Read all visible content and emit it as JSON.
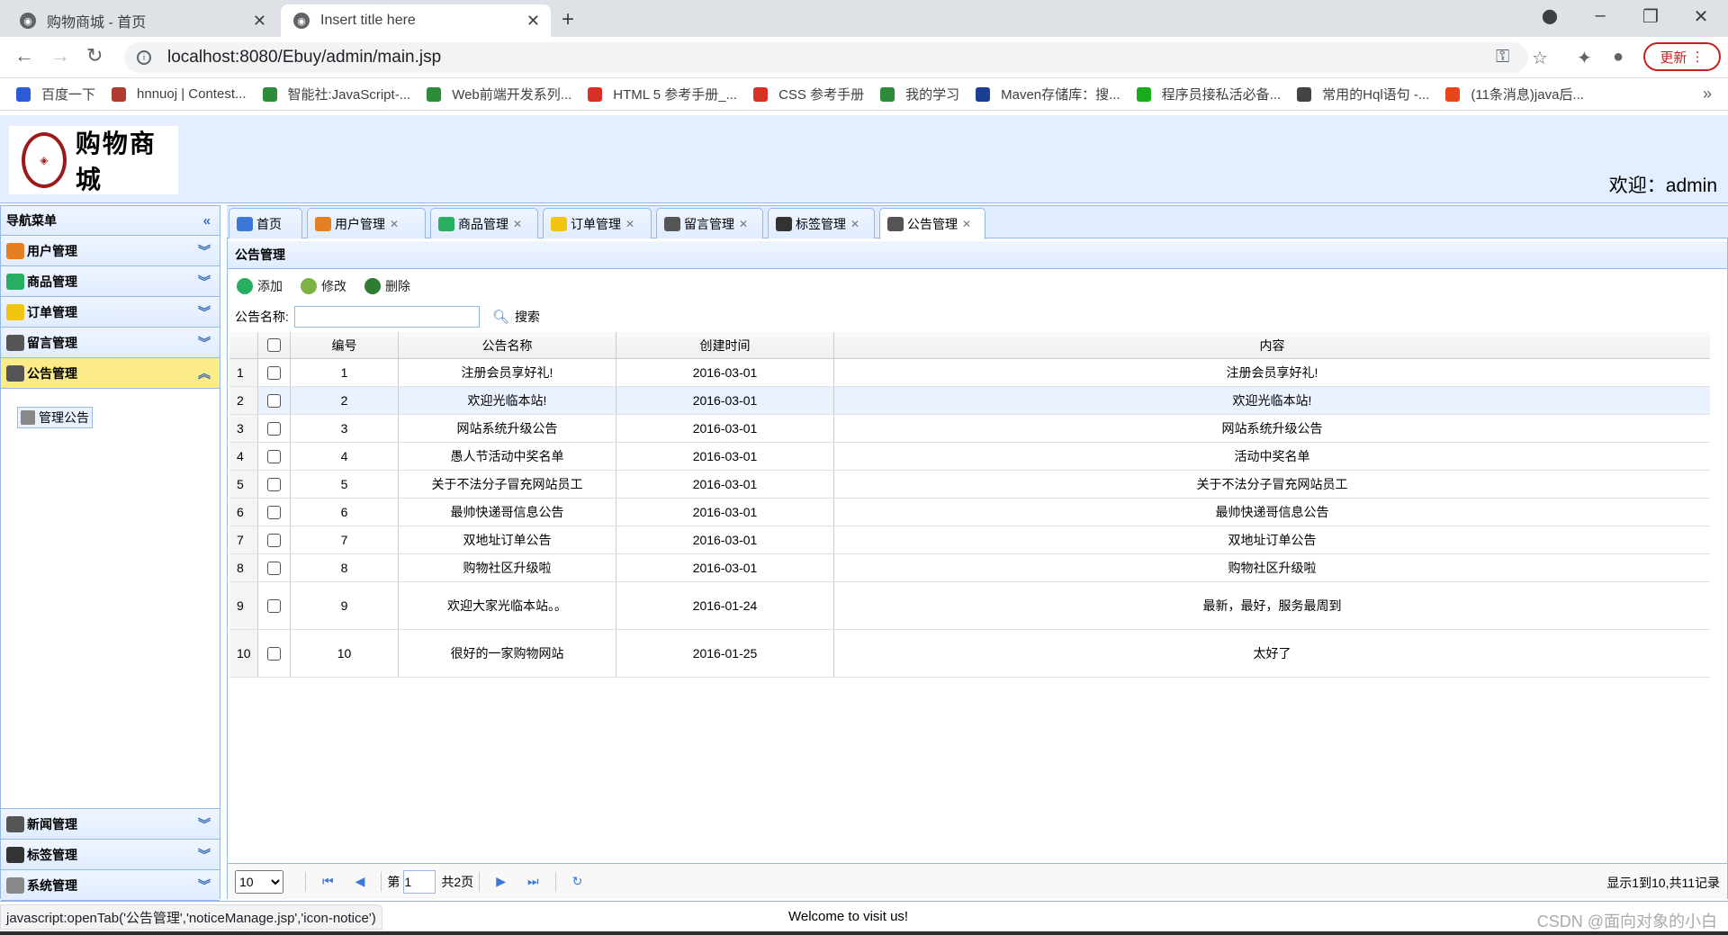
{
  "browser": {
    "tabs": [
      {
        "title": "购物商城 - 首页",
        "active": false
      },
      {
        "title": "Insert title here",
        "active": true
      }
    ],
    "url": "localhost:8080/Ebuy/admin/main.jsp",
    "update_label": "更新",
    "bookmarks": [
      {
        "label": "百度一下",
        "color": "#2b5bd7"
      },
      {
        "label": "hnnuoj | Contest...",
        "color": "#b03a2e"
      },
      {
        "label": "智能社:JavaScript-...",
        "color": "#2e8b3a"
      },
      {
        "label": "Web前端开发系列...",
        "color": "#2e8b3a"
      },
      {
        "label": "HTML 5 参考手册_...",
        "color": "#d93025"
      },
      {
        "label": "CSS 参考手册",
        "color": "#d93025"
      },
      {
        "label": "我的学习",
        "color": "#2e8b3a"
      },
      {
        "label": "Maven存储库：搜...",
        "color": "#1a3f8f"
      },
      {
        "label": "程序员接私活必备...",
        "color": "#1aad19"
      },
      {
        "label": "常用的Hql语句 -...",
        "color": "#444444"
      },
      {
        "label": "(11条消息)java后...",
        "color": "#e8461a"
      }
    ]
  },
  "header": {
    "logo_text": "购物商城",
    "welcome": "欢迎：admin"
  },
  "sidebar": {
    "title": "导航菜单",
    "groups_top": [
      {
        "label": "用户管理",
        "selected": false,
        "color": "#e67e22"
      },
      {
        "label": "商品管理",
        "selected": false,
        "color": "#27ae60"
      },
      {
        "label": "订单管理",
        "selected": false,
        "color": "#f1c40f"
      },
      {
        "label": "留言管理",
        "selected": false,
        "color": "#555555"
      },
      {
        "label": "公告管理",
        "selected": true,
        "color": "#555555"
      }
    ],
    "active_item": "管理公告",
    "groups_bottom": [
      {
        "label": "新闻管理",
        "color": "#555555"
      },
      {
        "label": "标签管理",
        "color": "#333333"
      },
      {
        "label": "系统管理",
        "color": "#888888"
      }
    ]
  },
  "main_tabs": [
    {
      "label": "首页",
      "closable": false,
      "active": false,
      "color": "#3c78d8"
    },
    {
      "label": "用户管理",
      "closable": true,
      "active": false,
      "color": "#e67e22"
    },
    {
      "label": "商品管理",
      "closable": true,
      "active": false,
      "color": "#27ae60"
    },
    {
      "label": "订单管理",
      "closable": true,
      "active": false,
      "color": "#f1c40f"
    },
    {
      "label": "留言管理",
      "closable": true,
      "active": false,
      "color": "#555555"
    },
    {
      "label": "标签管理",
      "closable": true,
      "active": false,
      "color": "#333333"
    },
    {
      "label": "公告管理",
      "closable": true,
      "active": true,
      "color": "#555555"
    }
  ],
  "panel": {
    "title": "公告管理",
    "toolbar": [
      {
        "label": "添加",
        "color": "#27ae60"
      },
      {
        "label": "修改",
        "color": "#7cb342"
      },
      {
        "label": "删除",
        "color": "#2e7d32"
      }
    ],
    "search_label": "公告名称:",
    "search_value": "",
    "search_button": "搜索"
  },
  "table": {
    "columns": [
      "编号",
      "公告名称",
      "创建时间",
      "内容"
    ],
    "rows": [
      {
        "rn": "1",
        "id": "1",
        "name": "注册会员享好礼!",
        "time": "2016-03-01",
        "content": "注册会员享好礼!"
      },
      {
        "rn": "2",
        "id": "2",
        "name": "欢迎光临本站!",
        "time": "2016-03-01",
        "content": "欢迎光临本站!"
      },
      {
        "rn": "3",
        "id": "3",
        "name": "网站系统升级公告",
        "time": "2016-03-01",
        "content": "网站系统升级公告"
      },
      {
        "rn": "4",
        "id": "4",
        "name": "愚人节活动中奖名单",
        "time": "2016-03-01",
        "content": "活动中奖名单"
      },
      {
        "rn": "5",
        "id": "5",
        "name": "关于不法分子冒充网站员工",
        "time": "2016-03-01",
        "content": "关于不法分子冒充网站员工"
      },
      {
        "rn": "6",
        "id": "6",
        "name": "最帅快递哥信息公告",
        "time": "2016-03-01",
        "content": "最帅快递哥信息公告"
      },
      {
        "rn": "7",
        "id": "7",
        "name": "双地址订单公告",
        "time": "2016-03-01",
        "content": "双地址订单公告"
      },
      {
        "rn": "8",
        "id": "8",
        "name": "购物社区升级啦",
        "time": "2016-03-01",
        "content": "购物社区升级啦"
      },
      {
        "rn": "9",
        "id": "9",
        "name": "欢迎大家光临本站。。",
        "time": "2016-01-24",
        "content": "最新，最好，服务最周到"
      },
      {
        "rn": "10",
        "id": "10",
        "name": "很好的一家购物网站",
        "time": "2016-01-25",
        "content": "太好了"
      }
    ]
  },
  "pager": {
    "page_size": "10",
    "page_prefix": "第",
    "page_value": "1",
    "page_total": "共2页",
    "info": "显示1到10,共11记录"
  },
  "footer": {
    "status_url": "javascript:openTab('公告管理','noticeManage.jsp','icon-notice')",
    "welcome": "Welcome to visit us!",
    "watermark": "CSDN @面向对象的小白"
  }
}
